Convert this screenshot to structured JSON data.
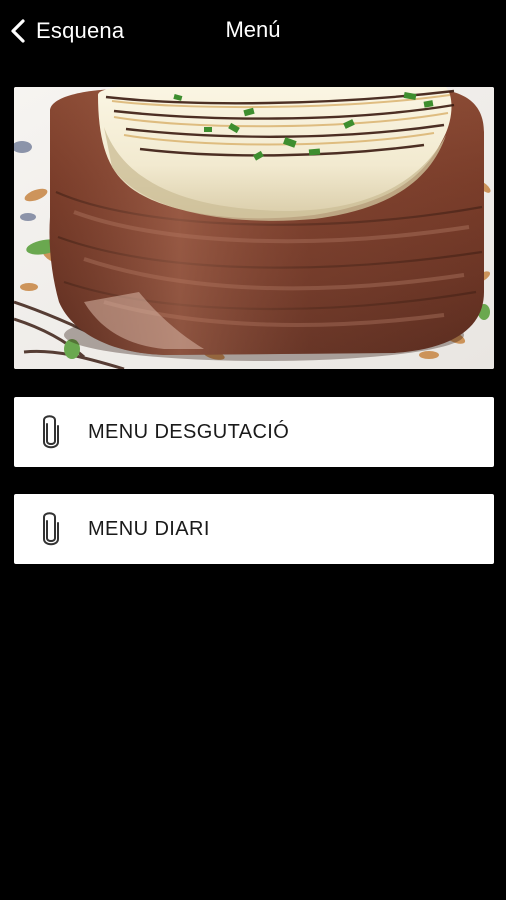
{
  "navbar": {
    "back_label": "Esquena",
    "back_icon": "chevron-left-icon",
    "title": "Menú"
  },
  "hero": {
    "subject": "goat cheese wrapped in bacon"
  },
  "menu_items": [
    {
      "label": "MENU DESGUTACIÓ",
      "icon": "paperclip-icon"
    },
    {
      "label": "MENU DIARI",
      "icon": "paperclip-icon"
    }
  ],
  "colors": {
    "background": "#000000",
    "nav_text": "#ffffff",
    "card_background": "#ffffff",
    "card_text": "#1a1a1a"
  }
}
